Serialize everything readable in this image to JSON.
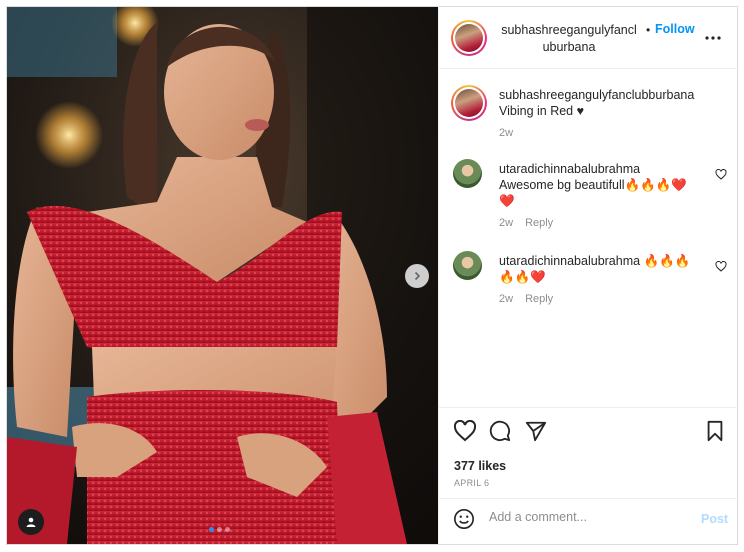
{
  "post": {
    "author": "subhashreegangulyfanclubburbana",
    "author_line1": "subhashreegangulyfancl",
    "author_line2": "uburbana",
    "separator": "•",
    "follow_label": "Follow",
    "more_icon": "more-horizontal-icon",
    "photo": {
      "carousel_slides": 3,
      "active_slide": 1,
      "next_icon": "chevron-right-icon",
      "tag_icon": "person-tag-icon",
      "palette": {
        "dress": "#c1182c",
        "skin": "#d9a27f",
        "hair": "#4a2e22",
        "background": "#2a221c"
      }
    }
  },
  "caption": {
    "username": "subhashreegangulyfanclubburbana",
    "text": "Vibing in Red ♥",
    "time": "2w"
  },
  "comments": [
    {
      "username": "utaradichinnabalubrahma",
      "text_line1": "Awesome bg beautifull🔥🔥🔥❤️",
      "text_line2": "❤️",
      "time": "2w",
      "reply_label": "Reply",
      "like_icon": "heart-outline-icon"
    },
    {
      "username": "utaradichinnabalubrahma",
      "text_line1": "🔥🔥🔥",
      "text_line2": "🔥🔥❤️",
      "time": "2w",
      "reply_label": "Reply",
      "like_icon": "heart-outline-icon"
    }
  ],
  "actions": {
    "like_icon": "heart-outline-icon",
    "comment_icon": "comment-bubble-icon",
    "share_icon": "paper-plane-icon",
    "save_icon": "bookmark-icon",
    "likes": "377 likes",
    "date": "APRIL 6"
  },
  "add_comment": {
    "emoji_icon": "smiley-icon",
    "placeholder": "Add a comment...",
    "post_label": "Post"
  },
  "colors": {
    "accent": "#0095f6",
    "post_disabled": "#b3dbff",
    "muted": "#8e8e8e",
    "border": "#dbdbdb"
  }
}
